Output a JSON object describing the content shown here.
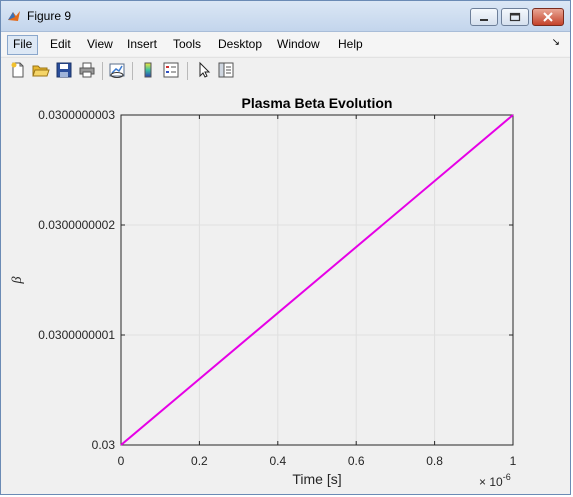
{
  "window": {
    "title": "Figure 9"
  },
  "menu": [
    "File",
    "Edit",
    "View",
    "Insert",
    "Tools",
    "Desktop",
    "Window",
    "Help"
  ],
  "toolbar": [
    "new-figure-icon",
    "open-file-icon",
    "save-icon",
    "print-icon",
    "link-plot-icon",
    "colorbar-icon",
    "legend-icon",
    "pointer-icon",
    "property-editor-icon"
  ],
  "chart_data": {
    "type": "line",
    "title": "Plasma Beta Evolution",
    "xlabel": "Time [s]",
    "ylabel": "β",
    "x_exponent": "× 10",
    "x_exponent_power": "-6",
    "xlim": [
      0,
      1
    ],
    "ylim": [
      0.03,
      0.0300000003
    ],
    "x_ticks": [
      "0",
      "0.2",
      "0.4",
      "0.6",
      "0.8",
      "1"
    ],
    "y_ticks": [
      "0.03",
      "0.0300000001",
      "0.0300000002",
      "0.0300000003"
    ],
    "grid": true,
    "series": [
      {
        "x": [
          0,
          1
        ],
        "y": [
          0.03,
          0.0300000003
        ],
        "color": "#e600e6"
      }
    ]
  }
}
